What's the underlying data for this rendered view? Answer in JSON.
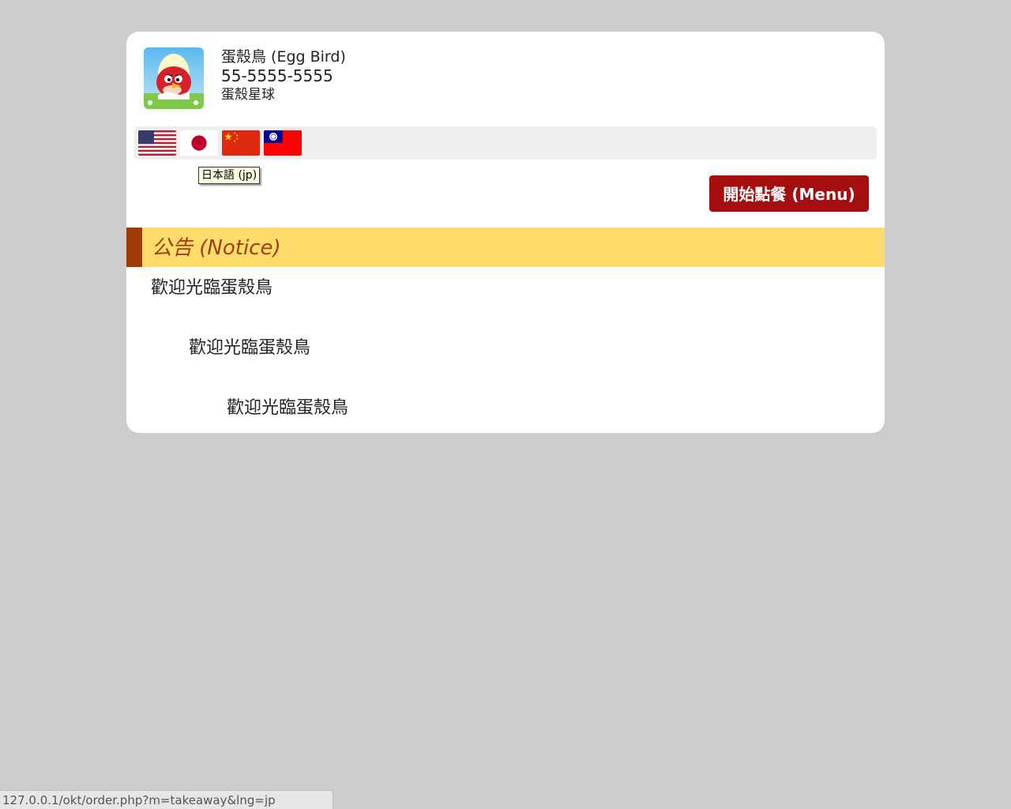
{
  "restaurant": {
    "name": "蛋殼鳥 (Egg Bird)",
    "phone": "55-5555-5555",
    "address": "蛋殼星球",
    "logo_icon": "angry-bird-egg-logo"
  },
  "languages": [
    {
      "code": "en",
      "flag_icon": "us-flag-icon"
    },
    {
      "code": "jp",
      "flag_icon": "japan-flag-icon"
    },
    {
      "code": "cn",
      "flag_icon": "china-flag-icon"
    },
    {
      "code": "tw",
      "flag_icon": "taiwan-flag-icon"
    }
  ],
  "tooltip": "日本語 (jp)",
  "menu_button": {
    "label": "開始點餐 (Menu)"
  },
  "notice": {
    "title": "公告 (Notice)",
    "lines": [
      "歡迎光臨蛋殼鳥",
      "歡迎光臨蛋殼鳥",
      "歡迎光臨蛋殼鳥"
    ]
  },
  "status_url": "127.0.0.1/okt/order.php?m=takeaway&lng=jp",
  "colors": {
    "page_background": "#cccccc",
    "menu_button": "#a50e0e",
    "notice_header": "#ffdc6b",
    "notice_accent": "#9e3b07",
    "notice_title_text": "#a0400a"
  }
}
